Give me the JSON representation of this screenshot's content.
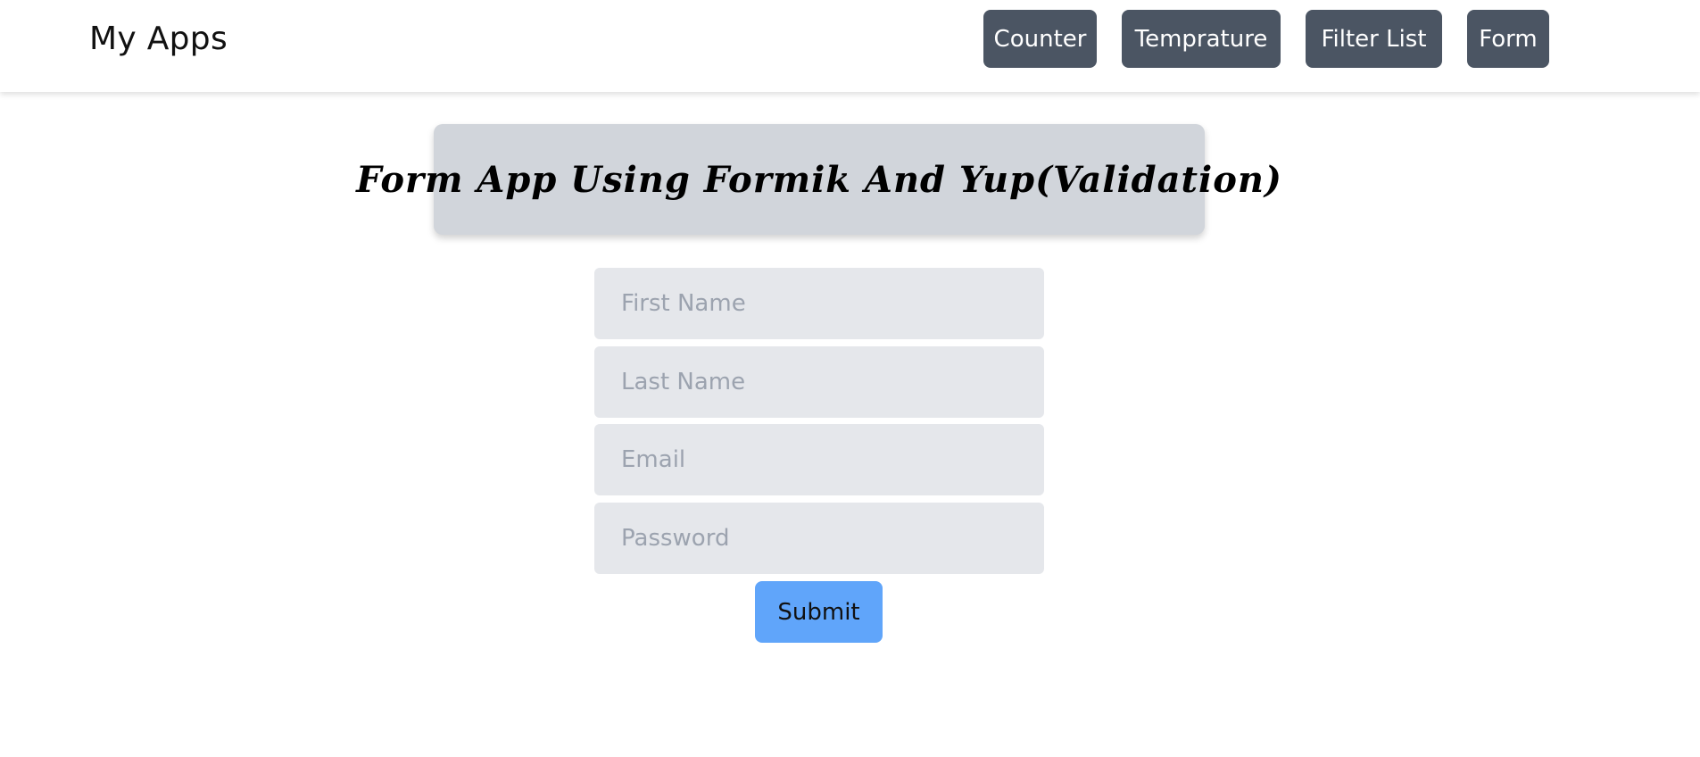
{
  "navbar": {
    "brand": "My Apps",
    "links": [
      "Counter",
      "Temprature",
      "Filter List",
      "Form"
    ]
  },
  "page": {
    "title": "Form App Using Formik And Yup(Validation)"
  },
  "form": {
    "first_name_placeholder": "First Name",
    "last_name_placeholder": "Last Name",
    "email_placeholder": "Email",
    "password_placeholder": "Password",
    "submit_label": "Submit"
  },
  "colors": {
    "nav_button": "#4b5563",
    "title_card": "#d1d5db",
    "input_bg": "#e5e7eb",
    "submit_button": "#60a5fa"
  }
}
